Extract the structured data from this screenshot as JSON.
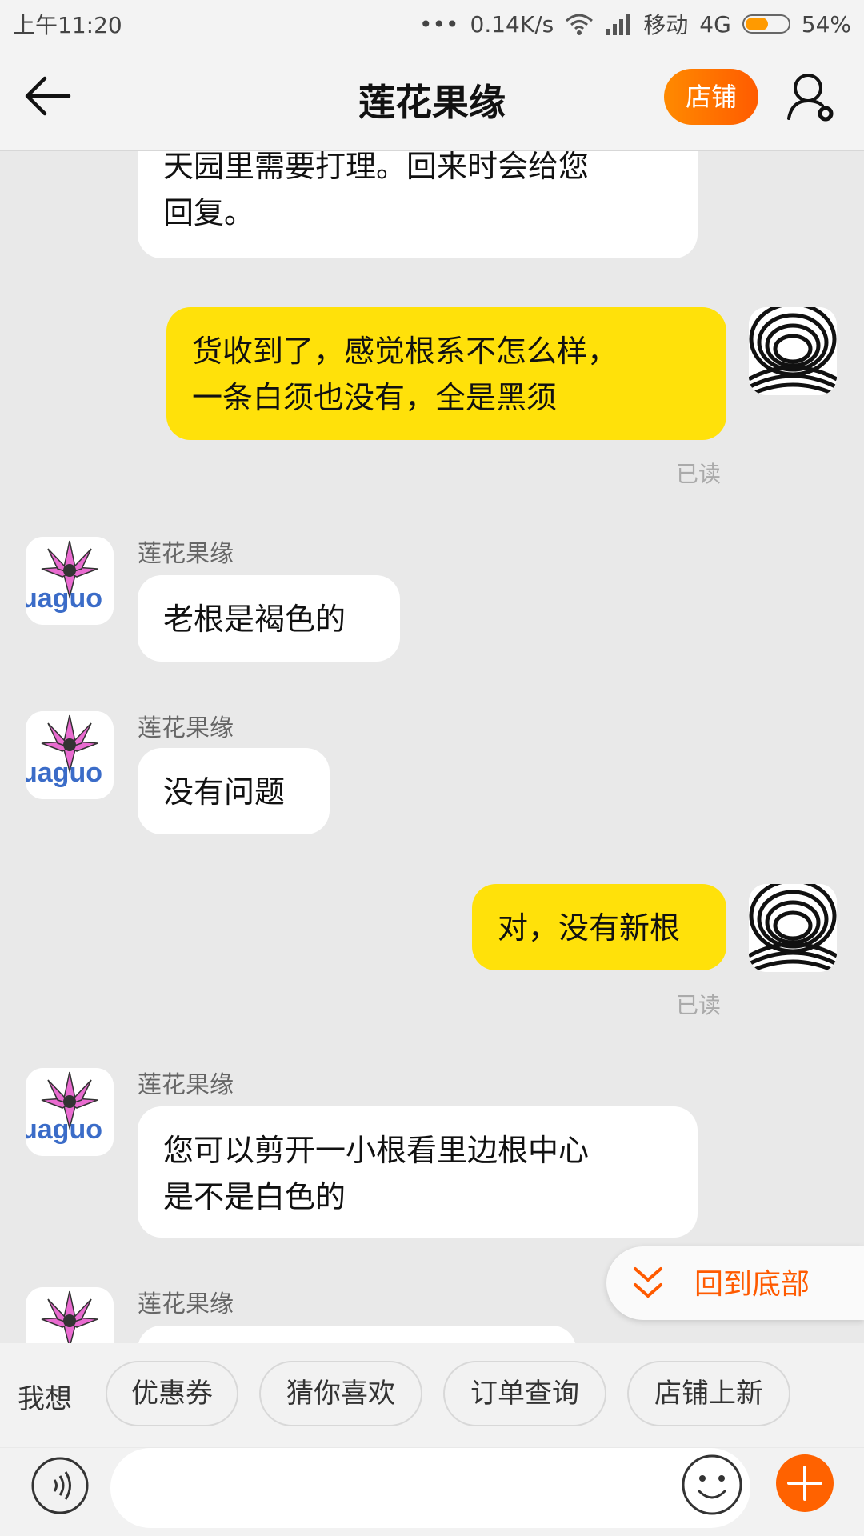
{
  "status_bar": {
    "time": "上午11:20",
    "dots": "•••",
    "speed": "0.14K/s",
    "carrier": "移动",
    "network": "4G",
    "battery": "54%",
    "battery_level_percent": 54,
    "icons": [
      "wifi-icon",
      "signal-icon",
      "battery-icon"
    ]
  },
  "header": {
    "title": "莲花果缘",
    "shop_button": "店铺",
    "icons": [
      "back-arrow-icon",
      "user-settings-icon"
    ]
  },
  "chat": {
    "messages": [
      {
        "from": "shop",
        "text_lines": [
          "天园里需要打理。回来时会给您",
          "回复。"
        ]
      },
      {
        "from": "me",
        "text_lines": [
          "货收到了，感觉根系不怎么样，",
          "一条白须也没有，全是黑须"
        ],
        "status": "已读"
      },
      {
        "from": "shop",
        "sender": "莲花果缘",
        "text_lines": [
          "老根是褐色的"
        ]
      },
      {
        "from": "shop",
        "sender": "莲花果缘",
        "text_lines": [
          "没有问题"
        ]
      },
      {
        "from": "me",
        "text_lines": [
          "对，没有新根"
        ],
        "status": "已读"
      },
      {
        "from": "shop",
        "sender": "莲花果缘",
        "text_lines": [
          "您可以剪开一小根看里边根中心",
          "是不是白色的"
        ]
      },
      {
        "from": "shop",
        "sender": "莲花果缘",
        "text_lines": []
      }
    ],
    "avatar_text": "uaguo",
    "scroll_bottom_label": "回到底部"
  },
  "quick_bar": {
    "label": "我想",
    "chips": [
      "优惠券",
      "猜你喜欢",
      "订单查询",
      "店铺上新"
    ]
  },
  "input_bar": {
    "placeholder": "",
    "icons": [
      "voice-icon",
      "emoji-icon",
      "plus-icon"
    ]
  },
  "colors": {
    "accent": "#ff5b00",
    "my_bubble": "#ffe10a",
    "background": "#e9e9e9"
  }
}
